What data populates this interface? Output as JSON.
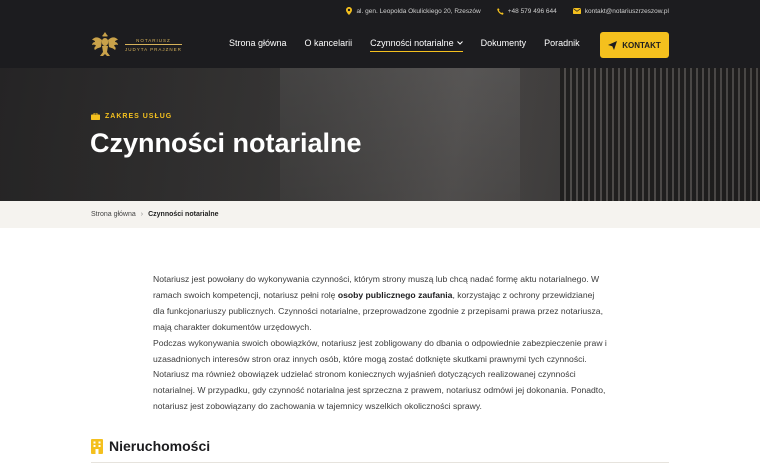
{
  "topbar": {
    "address": "al. gen. Leopolda Okulickiego 20, Rzeszów",
    "phone": "+48 579 496 644",
    "email": "kontakt@notariuszrzeszow.pl"
  },
  "logo": {
    "line1": "NOTARIUSZ",
    "line2": "JUDYTA PRAJZNER"
  },
  "nav": {
    "items": [
      {
        "label": "Strona główna"
      },
      {
        "label": "O kancelarii"
      },
      {
        "label": "Czynności notarialne",
        "active": true
      },
      {
        "label": "Dokumenty"
      },
      {
        "label": "Poradnik"
      }
    ],
    "cta": "KONTAKT"
  },
  "hero": {
    "kicker": "ZAKRES USŁUG",
    "title": "Czynności notarialne"
  },
  "breadcrumb": {
    "home": "Strona główna",
    "current": "Czynności notarialne"
  },
  "content": {
    "p1_a": "Notariusz jest powołany do wykonywania czynności, którym strony muszą lub chcą nadać formę aktu notarialnego. W ramach swoich kompetencji, notariusz pełni rolę ",
    "p1_bold": "osoby publicznego zaufania",
    "p1_b": ", korzystając z ochrony przewidzianej dla funkcjonariuszy publicznych. Czynności notarialne, przeprowadzone zgodnie z przepisami prawa przez notariusza, mają charakter dokumentów urzędowych.",
    "p2": "Podczas wykonywania swoich obowiązków, notariusz jest zobligowany do dbania o odpowiednie zabezpieczenie praw i uzasadnionych interesów stron oraz innych osób, które mogą zostać dotknięte skutkami prawnymi tych czynności. Notariusz ma również obowiązek udzielać stronom koniecznych wyjaśnień dotyczących realizowanej czynności notarialnej. W przypadku, gdy czynność notarialna jest sprzeczna z prawem, notariusz odmówi jej dokonania. Ponadto, notariusz jest zobowiązany do zachowania w tajemnicy wszelkich okoliczności sprawy."
  },
  "section": {
    "title": "Nieruchomości",
    "icon": "building-icon"
  },
  "colors": {
    "accent": "#f4c01e",
    "header_bg": "#1c1c1f",
    "breadcrumb_bg": "#f5f3ef"
  }
}
